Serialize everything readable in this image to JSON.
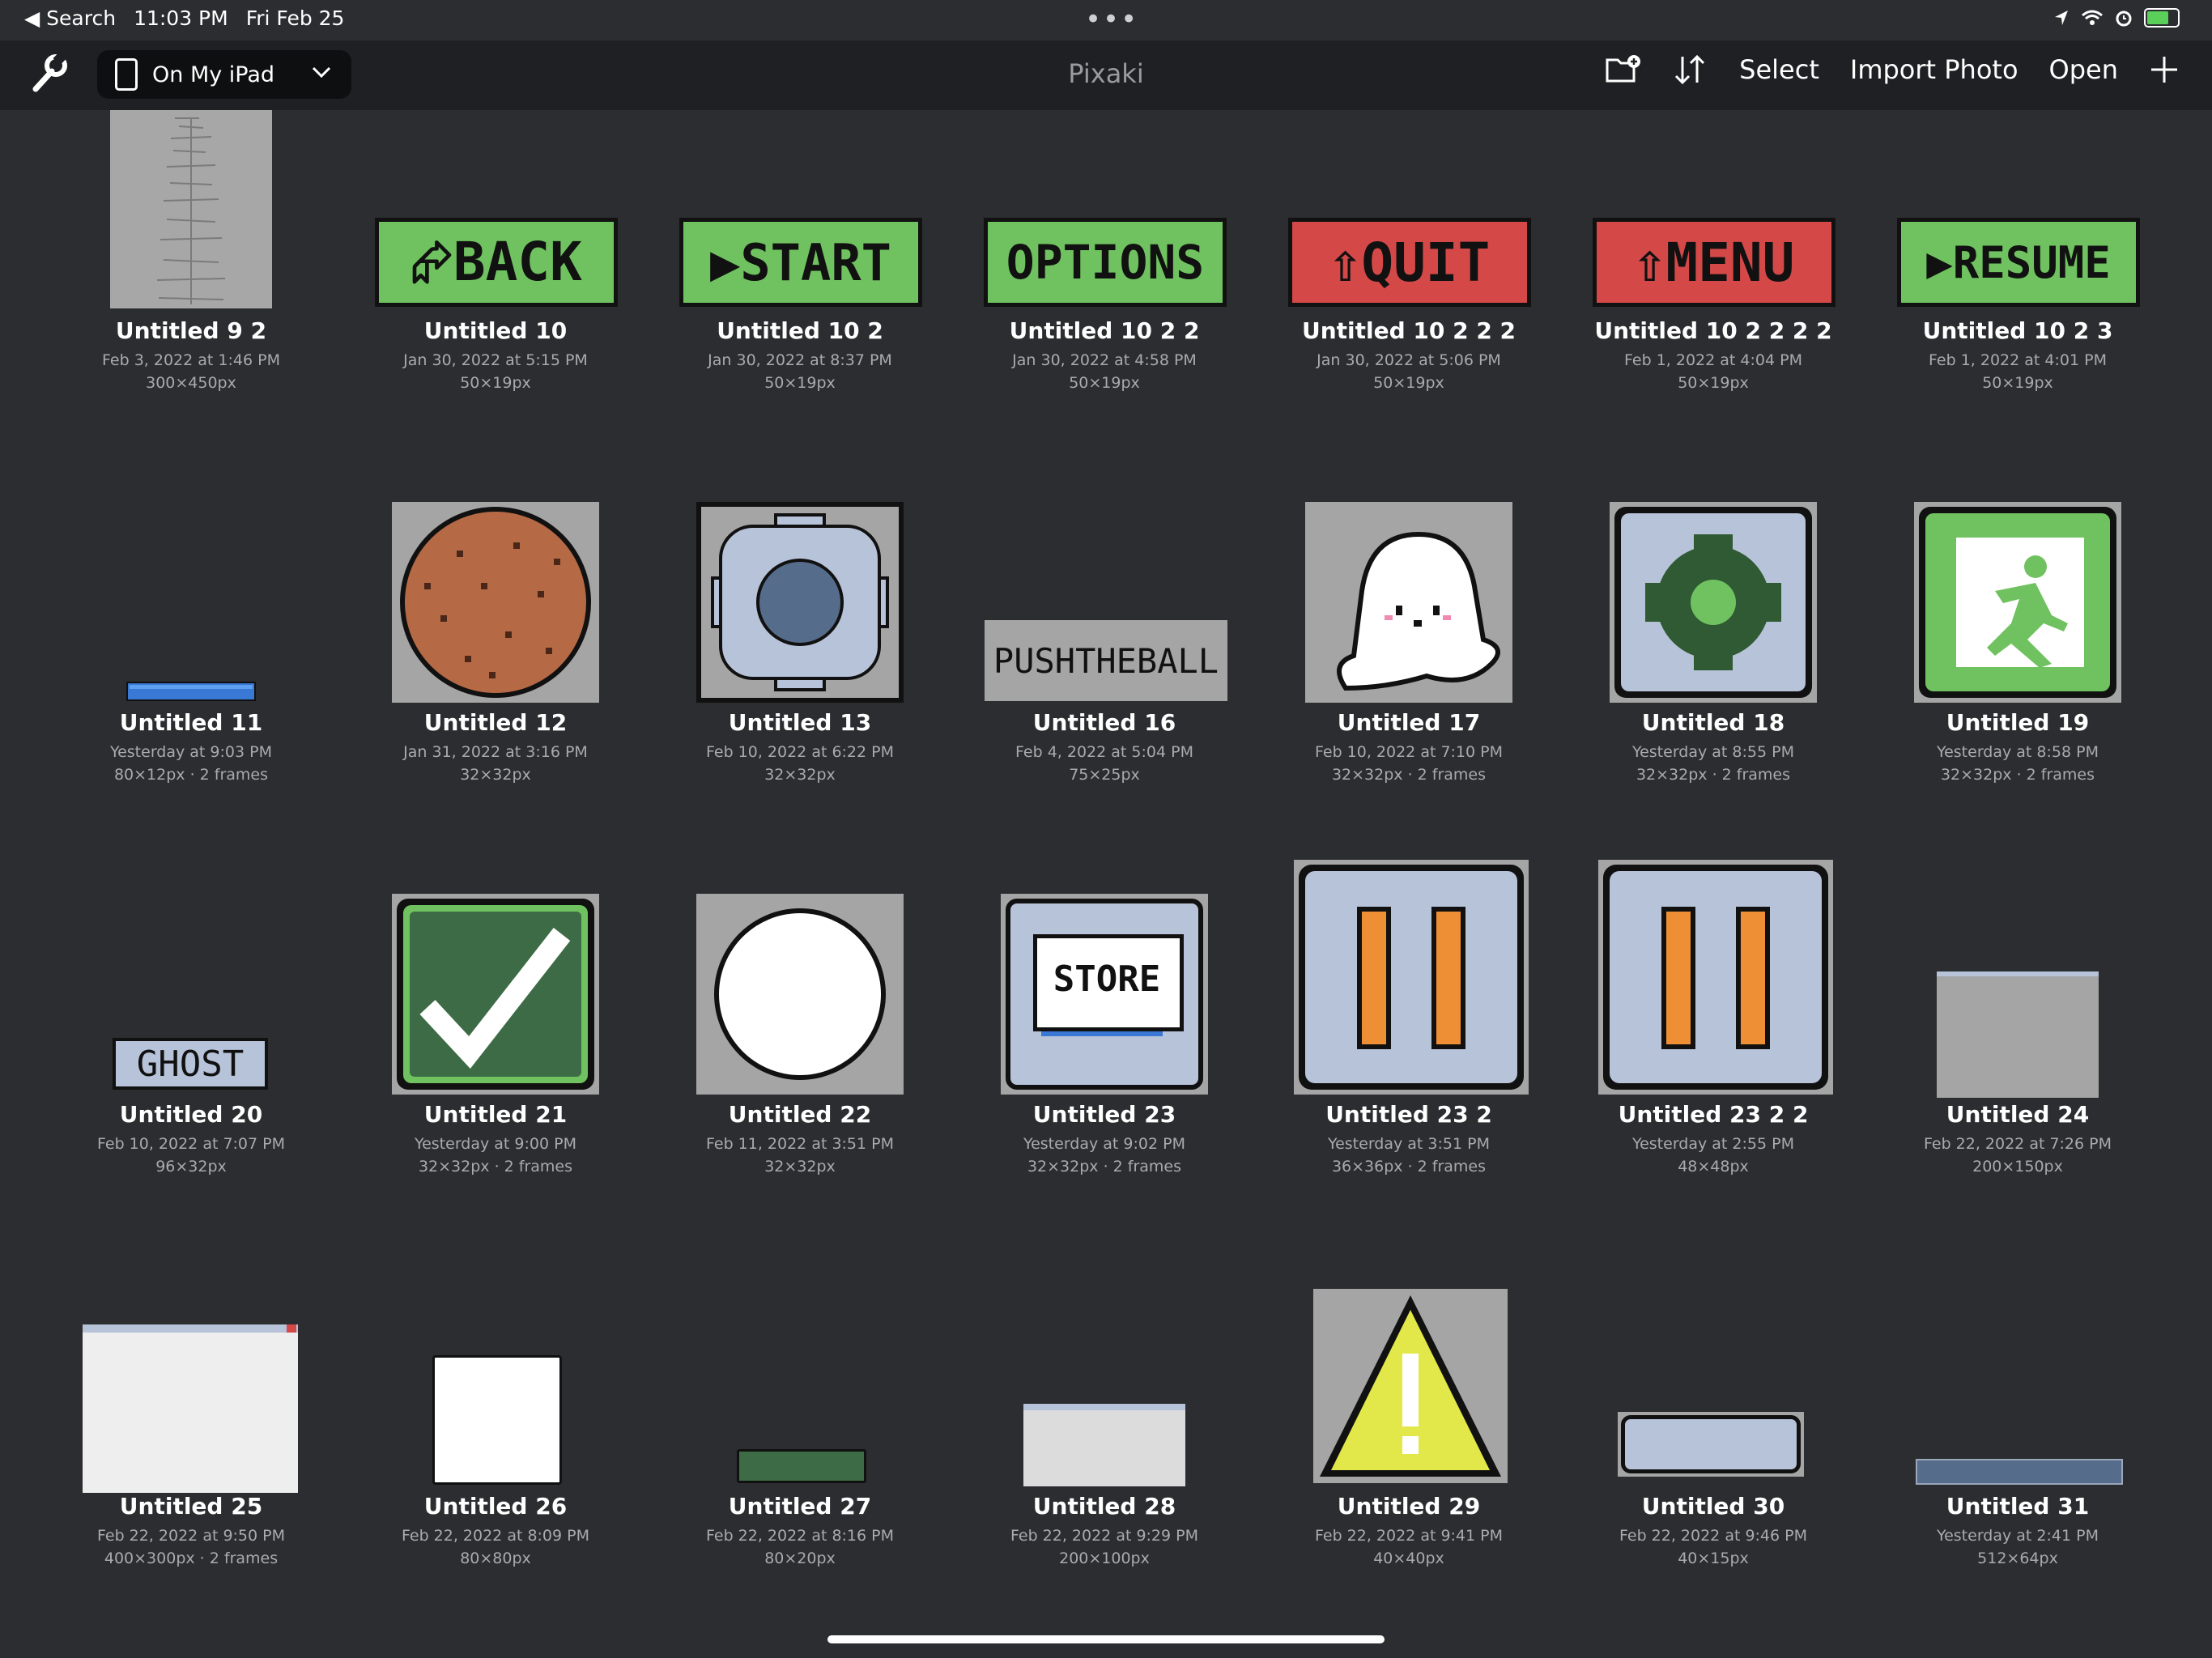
{
  "status_bar": {
    "back_label": "◀ Search",
    "time": "11:03 PM",
    "date": "Fri Feb 25",
    "more": "•••"
  },
  "toolbar": {
    "location": "On My iPad",
    "app_title": "Pixaki",
    "select": "Select",
    "import_photo": "Import Photo",
    "open": "Open"
  },
  "files": [
    {
      "name": "Untitled 9 2",
      "date": "Feb 3, 2022 at 1:46 PM",
      "size": "300×450px"
    },
    {
      "name": "Untitled 10",
      "date": "Jan 30, 2022 at 5:15 PM",
      "size": "50×19px",
      "text": "⮳BACK"
    },
    {
      "name": "Untitled 10 2",
      "date": "Jan 30, 2022 at 8:37 PM",
      "size": "50×19px",
      "text": "▶START"
    },
    {
      "name": "Untitled 10 2 2",
      "date": "Jan 30, 2022 at 4:58 PM",
      "size": "50×19px",
      "text": "OPTIONS"
    },
    {
      "name": "Untitled 10 2 2 2",
      "date": "Jan 30, 2022 at 5:06 PM",
      "size": "50×19px",
      "text": "⇧QUIT"
    },
    {
      "name": "Untitled 10 2 2 2 2",
      "date": "Feb 1, 2022 at 4:04 PM",
      "size": "50×19px",
      "text": "⇧MENU"
    },
    {
      "name": "Untitled 10 2 3",
      "date": "Feb 1, 2022 at 4:01 PM",
      "size": "50×19px",
      "text": "▶RESUME"
    },
    {
      "name": "Untitled 11",
      "date": "Yesterday at 9:03 PM",
      "size": "80×12px · 2 frames"
    },
    {
      "name": "Untitled 12",
      "date": "Jan 31, 2022 at 3:16 PM",
      "size": "32×32px"
    },
    {
      "name": "Untitled 13",
      "date": "Feb 10, 2022 at 6:22 PM",
      "size": "32×32px"
    },
    {
      "name": "Untitled 16",
      "date": "Feb 4, 2022 at 5:04 PM",
      "size": "75×25px",
      "text": "PUSHTHEBALL"
    },
    {
      "name": "Untitled 17",
      "date": "Feb 10, 2022 at 7:10 PM",
      "size": "32×32px · 2 frames"
    },
    {
      "name": "Untitled 18",
      "date": "Yesterday at 8:55 PM",
      "size": "32×32px · 2 frames"
    },
    {
      "name": "Untitled 19",
      "date": "Yesterday at 8:58 PM",
      "size": "32×32px · 2 frames"
    },
    {
      "name": "Untitled 20",
      "date": "Feb 10, 2022 at 7:07 PM",
      "size": "96×32px",
      "text": "GHOST"
    },
    {
      "name": "Untitled 21",
      "date": "Yesterday at 9:00 PM",
      "size": "32×32px · 2 frames"
    },
    {
      "name": "Untitled 22",
      "date": "Feb 11, 2022 at 3:51 PM",
      "size": "32×32px"
    },
    {
      "name": "Untitled 23",
      "date": "Yesterday at 9:02 PM",
      "size": "32×32px · 2 frames",
      "text": "STORE"
    },
    {
      "name": "Untitled 23 2",
      "date": "Yesterday at 3:51 PM",
      "size": "36×36px · 2 frames"
    },
    {
      "name": "Untitled 23 2 2",
      "date": "Yesterday at 2:55 PM",
      "size": "48×48px"
    },
    {
      "name": "Untitled 24",
      "date": "Feb 22, 2022 at 7:26 PM",
      "size": "200×150px"
    },
    {
      "name": "Untitled 25",
      "date": "Feb 22, 2022 at 9:50 PM",
      "size": "400×300px · 2 frames"
    },
    {
      "name": "Untitled 26",
      "date": "Feb 22, 2022 at 8:09 PM",
      "size": "80×80px"
    },
    {
      "name": "Untitled 27",
      "date": "Feb 22, 2022 at 8:16 PM",
      "size": "80×20px"
    },
    {
      "name": "Untitled 28",
      "date": "Feb 22, 2022 at 9:29 PM",
      "size": "200×100px"
    },
    {
      "name": "Untitled 29",
      "date": "Feb 22, 2022 at 9:41 PM",
      "size": "40×40px"
    },
    {
      "name": "Untitled 30",
      "date": "Feb 22, 2022 at 9:46 PM",
      "size": "40×15px"
    },
    {
      "name": "Untitled 31",
      "date": "Yesterday at 2:41 PM",
      "size": "512×64px"
    }
  ]
}
